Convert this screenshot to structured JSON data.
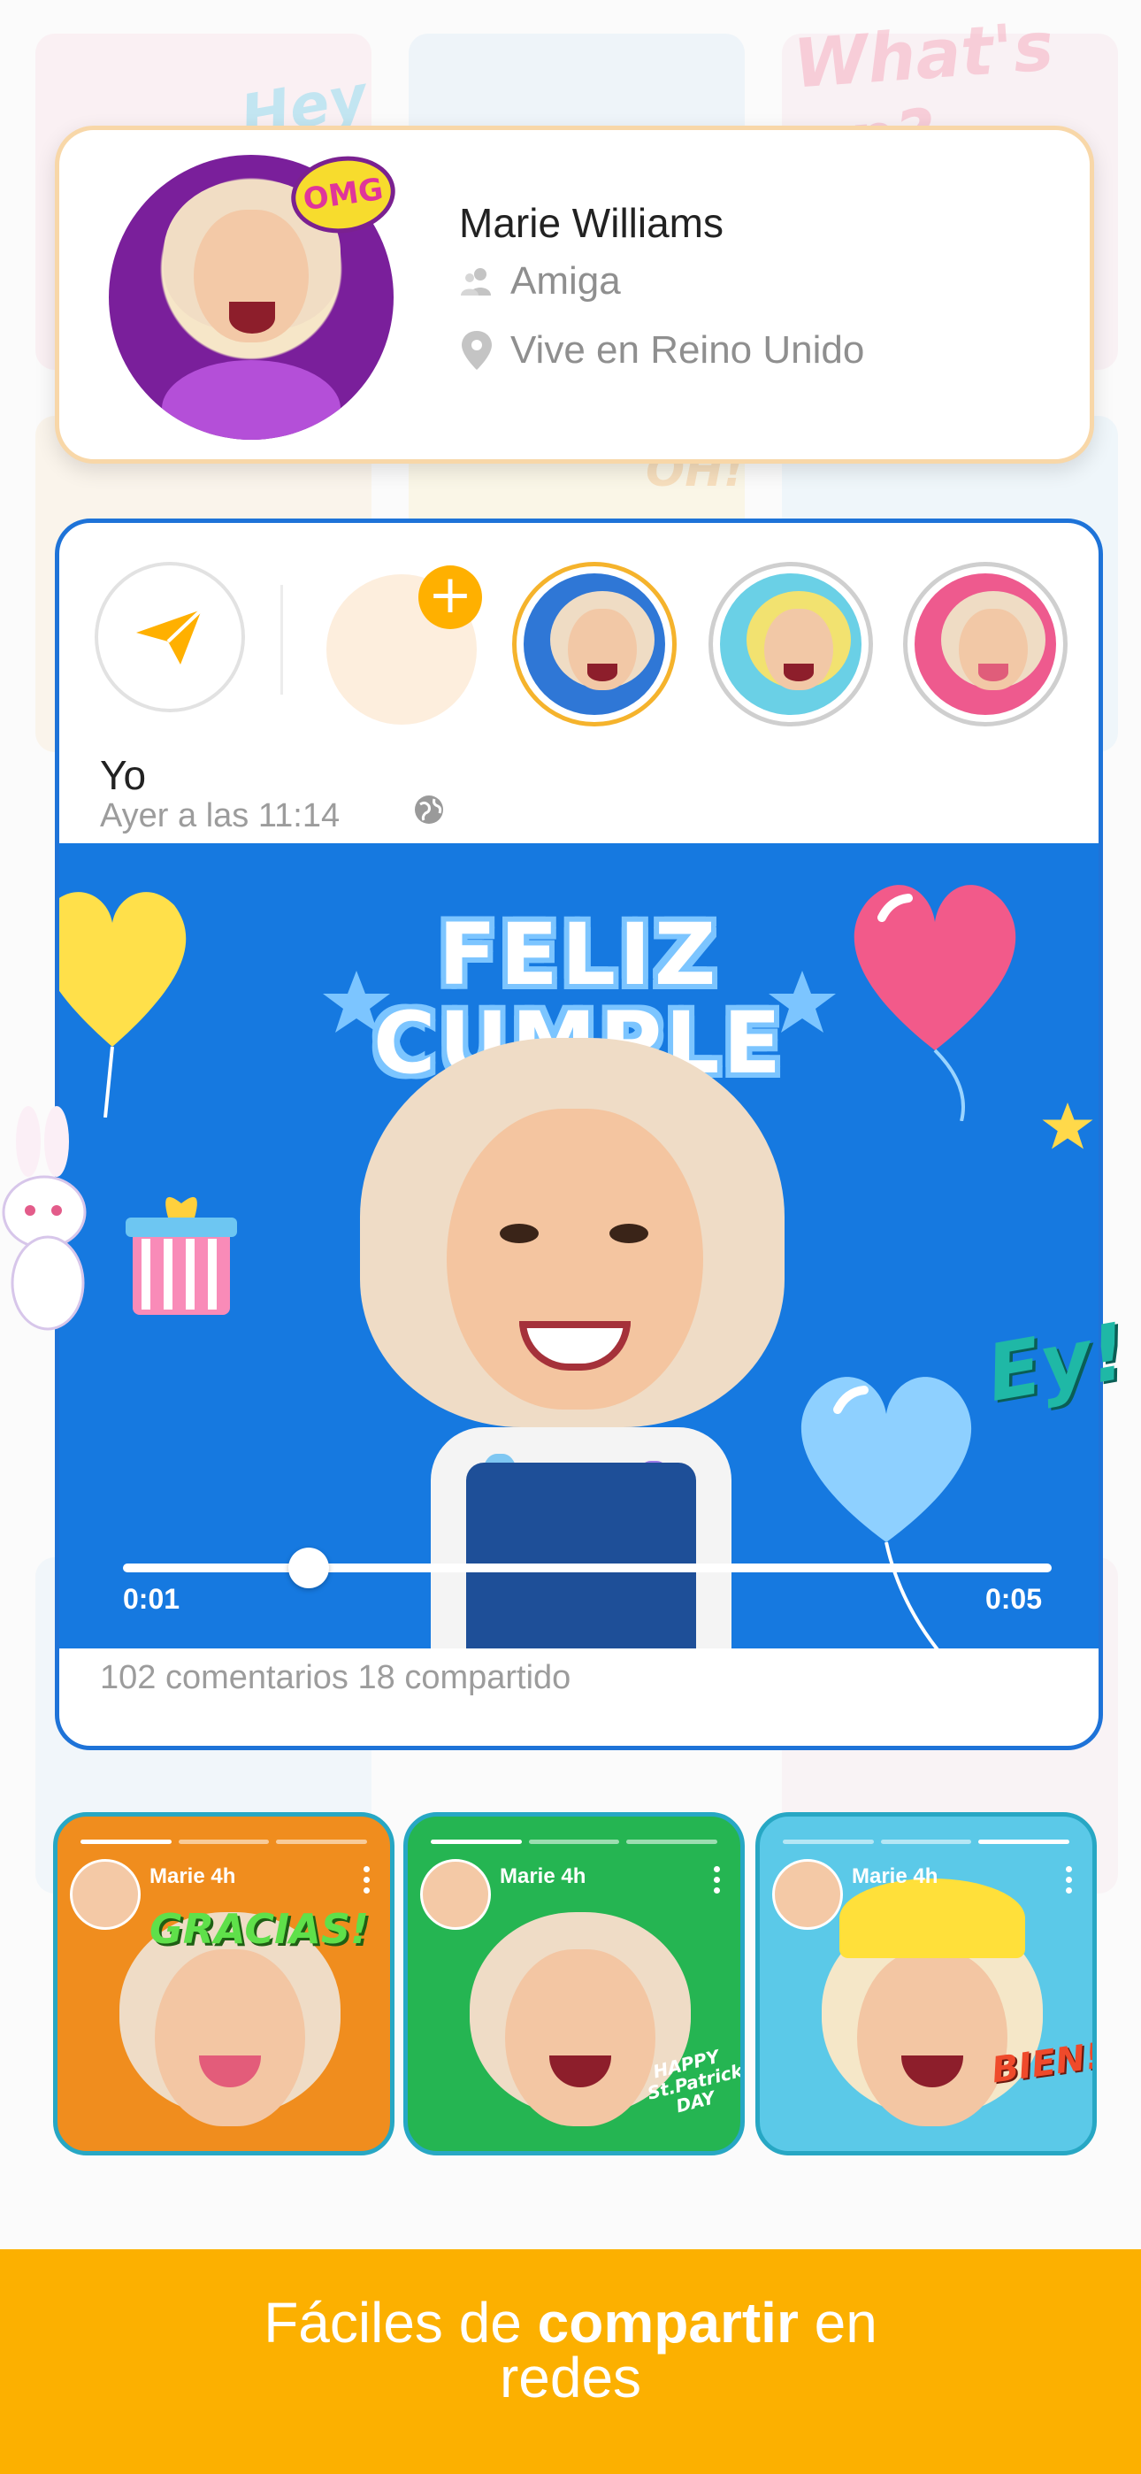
{
  "profile": {
    "name": "Marie Williams",
    "relation": "Amiga",
    "location": "Vive en Reino Unido",
    "badge": "OMG"
  },
  "background": {
    "watermark_top_right": "What's up?",
    "watermark_top_left": "Hey",
    "watermark_mid": "OH!"
  },
  "post": {
    "user": "Yo",
    "timestamp": "Ayer a las 11:14",
    "media_title_line1": "FELIZ",
    "media_title_line2": "CUMPLE",
    "sticker_ey": "Ey!",
    "time_current": "0:01",
    "time_total": "0:05",
    "progress": 0.2,
    "stats": "102 comentarios 18 compartido"
  },
  "stories": [
    {
      "label": "Marie 4h",
      "sticker": "GRACIAS!",
      "bg": "#f08d1e"
    },
    {
      "label": "Marie 4h",
      "sticker": "HAPPY St.Patrick's DAY",
      "bg": "#25b552"
    },
    {
      "label": "Marie 4h",
      "sticker": "BIEN!",
      "bg": "#5bc9e8"
    }
  ],
  "footer": {
    "text_regular_1": "Fáciles de ",
    "text_bold": "compartir",
    "text_regular_2": " en",
    "text_line2": "redes"
  },
  "colors": {
    "accent": "#fcb000",
    "feed_border": "#1e73d8",
    "media_bg": "#1679e0"
  }
}
